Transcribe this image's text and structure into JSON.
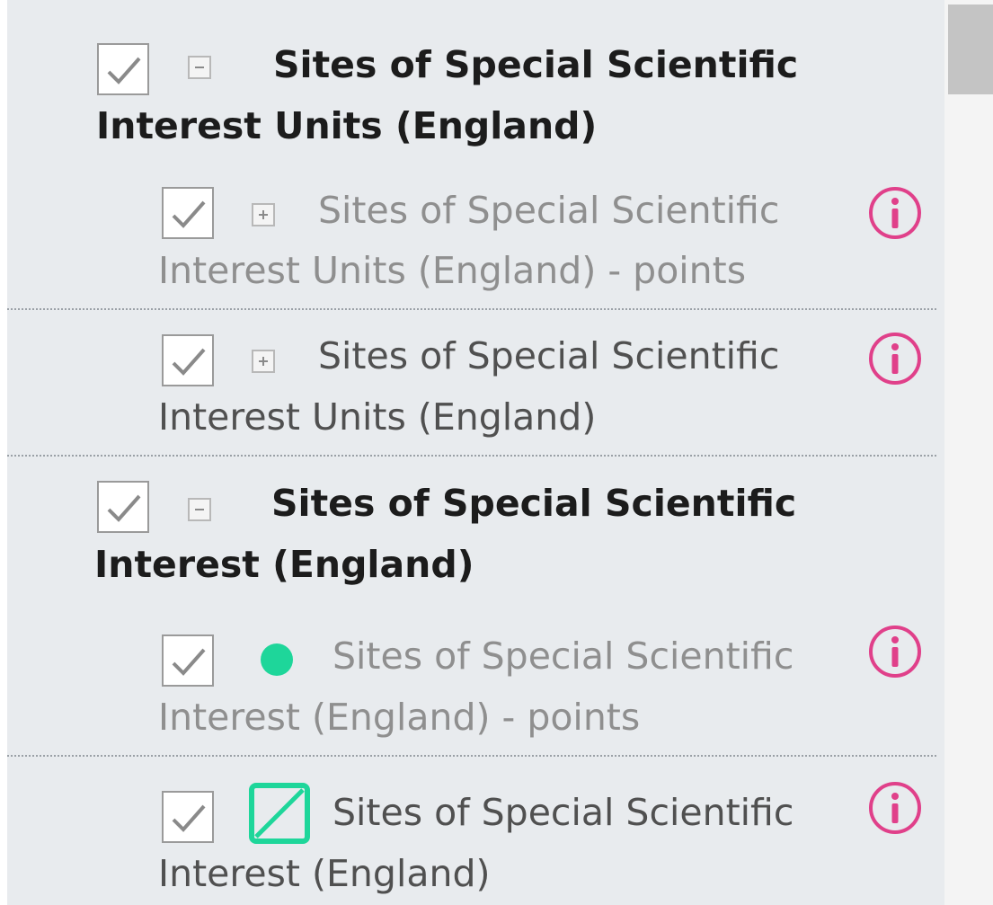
{
  "layer_list": {
    "groups": [
      {
        "title_line1": "Sites of Special Scientific",
        "title_line2": "Interest Units (England)",
        "checked": true,
        "expanded": true,
        "layers": [
          {
            "name_line1": "Sites of Special Scientific",
            "name_line2": "Interest Units (England) - points",
            "checked": true,
            "symbol": "plus-expander",
            "info_icon": "info-icon"
          },
          {
            "name_line1": "Sites of Special Scientific",
            "name_line2": "Interest Units (England)",
            "checked": true,
            "symbol": "plus-expander",
            "info_icon": "info-icon"
          }
        ]
      },
      {
        "title_line1": "Sites of Special Scientific",
        "title_line2": "Interest (England)",
        "checked": true,
        "expanded": true,
        "layers": [
          {
            "name_line1": "Sites of Special Scientific",
            "name_line2": "Interest (England) - points",
            "checked": true,
            "symbol": "point-symbol",
            "info_icon": "info-icon"
          },
          {
            "name_line1": "Sites of Special Scientific",
            "name_line2": "Interest (England)",
            "checked": true,
            "symbol": "polygon-symbol",
            "info_icon": "info-icon"
          }
        ]
      }
    ]
  },
  "colors": {
    "panel_background": "#e8ebee",
    "info_icon": "#e0408a",
    "symbol_green": "#1ed69a",
    "checkmark": "#8a8a8a"
  }
}
